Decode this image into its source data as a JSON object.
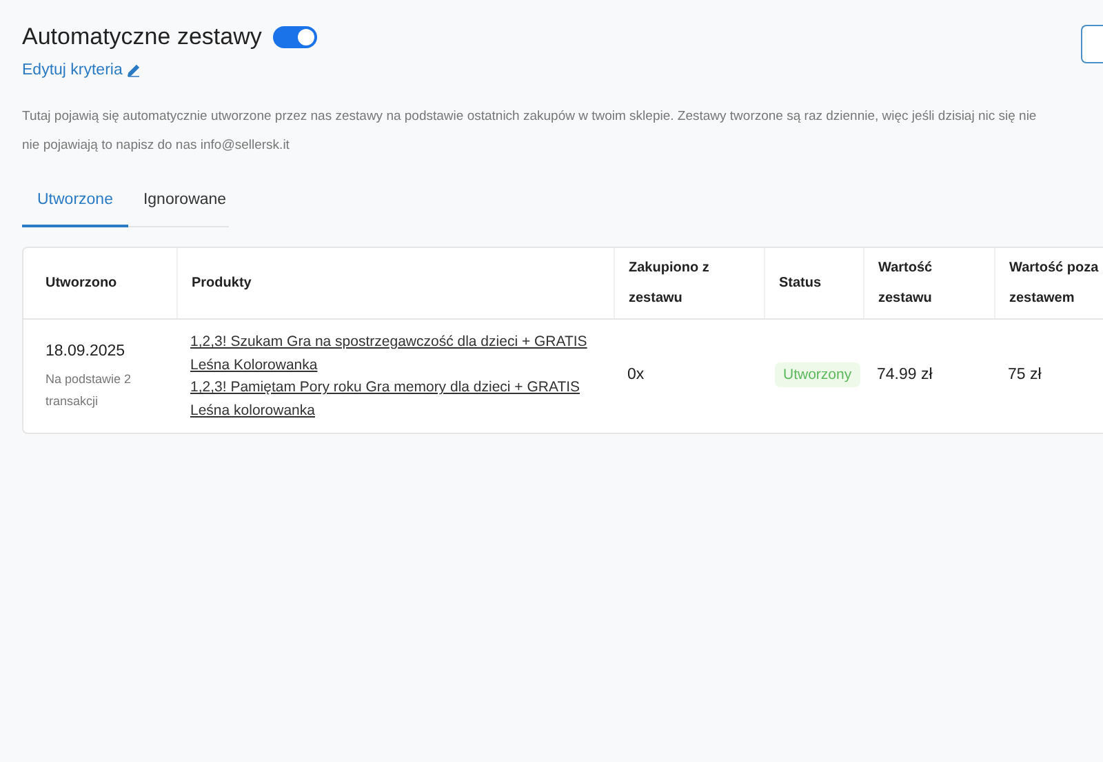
{
  "header": {
    "title": "Automatyczne zestawy",
    "auto_enabled": true,
    "edit_link": "Edytuj kryteria"
  },
  "description": [
    "Tutaj pojawią się automatycznie utworzone przez nas zestawy na podstawie ostatnich zakupów w twoim sklepie. Zestawy tworzone są raz dziennie, więc jeśli dzisiaj nic się nie",
    "nie pojawiają to napisz do nas info@sellersk.it"
  ],
  "tabs": [
    {
      "label": "Utworzone",
      "selected": true
    },
    {
      "label": "Ignorowane",
      "selected": false
    }
  ],
  "table": {
    "columns": [
      "Utworzono",
      "Produkty",
      "Zakupiono z zestawu",
      "Status",
      "Wartość zestawu",
      "Wartość poza zestawem"
    ],
    "rows": [
      {
        "date": "18.09.2025",
        "note": "Na podstawie 2 transakcji",
        "products": [
          "1,2,3! Szukam Gra na spostrzegawczość dla dzieci + GRATIS Leśna Kolorowanka",
          "1,2,3! Pamiętam Pory roku Gra memory dla dzieci + GRATIS Leśna kolorowanka"
        ],
        "purchased": "0x",
        "status": "Utworzony",
        "set_value": "74.99 zł",
        "outside_value": "75 zł"
      }
    ]
  }
}
